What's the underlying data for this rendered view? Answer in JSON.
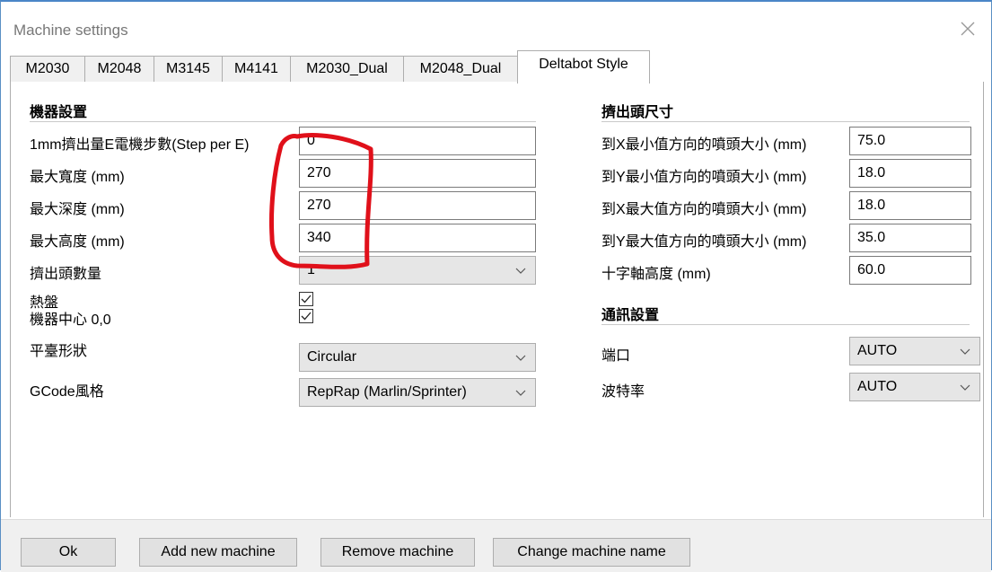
{
  "window": {
    "title": "Machine settings"
  },
  "tabs": [
    {
      "label": "M2030"
    },
    {
      "label": "M2048"
    },
    {
      "label": "M3145"
    },
    {
      "label": "M4141"
    },
    {
      "label": "M2030_Dual"
    },
    {
      "label": "M2048_Dual"
    },
    {
      "label": "Deltabot Style",
      "active": true
    }
  ],
  "machine": {
    "section_title": "機器設置",
    "steps_label": "1mm擠出量E電機步數(Step per E)",
    "steps_value": "0",
    "width_label": "最大寬度 (mm)",
    "width_value": "270",
    "depth_label": "最大深度 (mm)",
    "depth_value": "270",
    "height_label": "最大高度 (mm)",
    "height_value": "340",
    "extruders_label": "擠出頭數量",
    "extruders_value": "1",
    "heated_bed_label": "熱盤",
    "heated_bed_checked": true,
    "center_label": "機器中心 0,0",
    "center_checked": true,
    "bed_shape_label": "平臺形狀",
    "bed_shape_value": "Circular",
    "gcode_label": "GCode風格",
    "gcode_value": "RepRap (Marlin/Sprinter)"
  },
  "printhead": {
    "section_title": "擠出頭尺寸",
    "min_x_label": "到X最小值方向的噴頭大小 (mm)",
    "min_x_value": "75.0",
    "min_y_label": "到Y最小值方向的噴頭大小 (mm)",
    "min_y_value": "18.0",
    "max_x_label": "到X最大值方向的噴頭大小 (mm)",
    "max_x_value": "18.0",
    "max_y_label": "到Y最大值方向的噴頭大小 (mm)",
    "max_y_value": "35.0",
    "gantry_label": "十字軸高度 (mm)",
    "gantry_value": "60.0"
  },
  "comm": {
    "section_title": "通訊設置",
    "port_label": "端口",
    "port_value": "AUTO",
    "baud_label": "波特率",
    "baud_value": "AUTO"
  },
  "buttons": {
    "ok": "Ok",
    "add": "Add new machine",
    "remove": "Remove machine",
    "rename": "Change machine name"
  },
  "colors": {
    "annotation": "#e0101a",
    "window_border": "#4a86c7"
  }
}
